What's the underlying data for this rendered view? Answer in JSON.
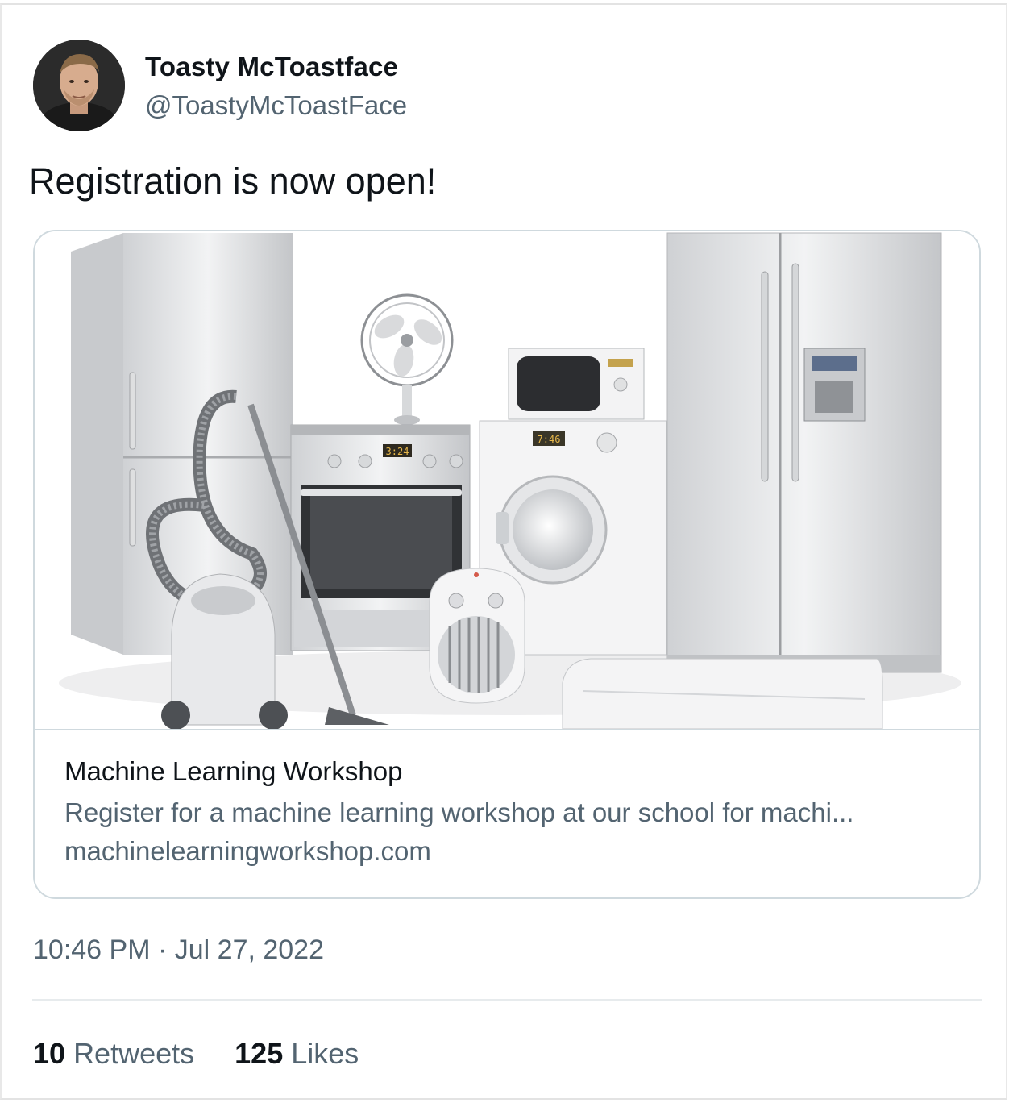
{
  "tweet": {
    "display_name": "Toasty McToastface",
    "handle": "@ToastyMcToastFace",
    "text": "Registration is now open!",
    "timestamp": "10:46 PM · Jul 27, 2022",
    "retweets_count": "10",
    "retweets_label": "Retweets",
    "likes_count": "125",
    "likes_label": "Likes"
  },
  "card": {
    "title": "Machine Learning Workshop",
    "description": "Register for a machine learning workshop at our school for machi...",
    "url": "machinelearningworkshop.com",
    "oven_clock": "3:24",
    "washer_clock": "7:46"
  },
  "colors": {
    "text_primary": "#0f1419",
    "text_secondary": "#536471",
    "border": "#cfd9de"
  }
}
